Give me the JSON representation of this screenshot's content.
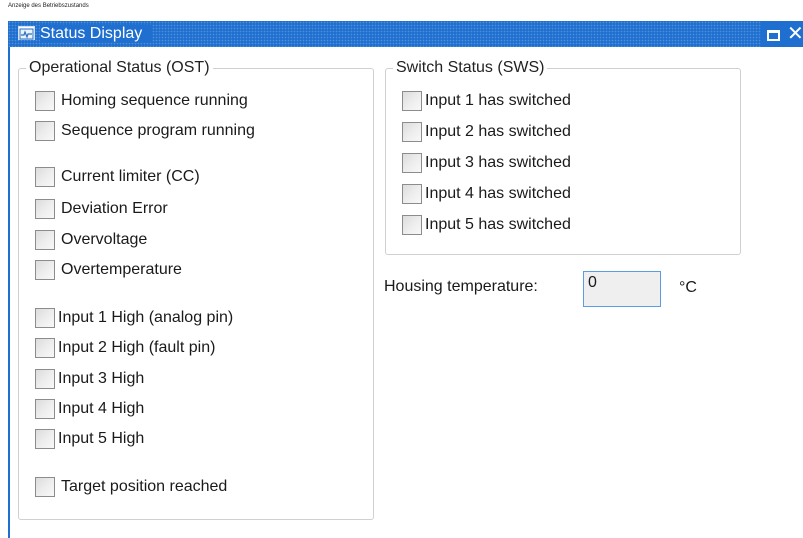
{
  "caption": "Anzeige des Betriebszustands",
  "window": {
    "title": "Status Display",
    "icon": "monitor-icon",
    "maximize_icon": "maximize-icon",
    "close_icon": "close-icon",
    "close_glyph": "✕",
    "accent": "#1e6fd0"
  },
  "operational_status": {
    "legend": "Operational Status (OST)",
    "items": [
      "Homing sequence running",
      "Sequence program running",
      "Current limiter (CC)",
      "Deviation Error",
      "Overvoltage",
      "Overtemperature",
      "Input 1 High (analog pin)",
      "Input 2 High (fault pin)",
      "Input 3 High",
      "Input 4 High",
      "Input 5 High",
      "Target position reached"
    ]
  },
  "switch_status": {
    "legend": "Switch Status (SWS)",
    "items": [
      "Input 1 has switched",
      "Input 2 has switched",
      "Input 3 has switched",
      "Input 4 has switched",
      "Input 5 has switched"
    ]
  },
  "housing_temperature": {
    "label": "Housing temperature:",
    "value": "0",
    "unit": "°C"
  }
}
